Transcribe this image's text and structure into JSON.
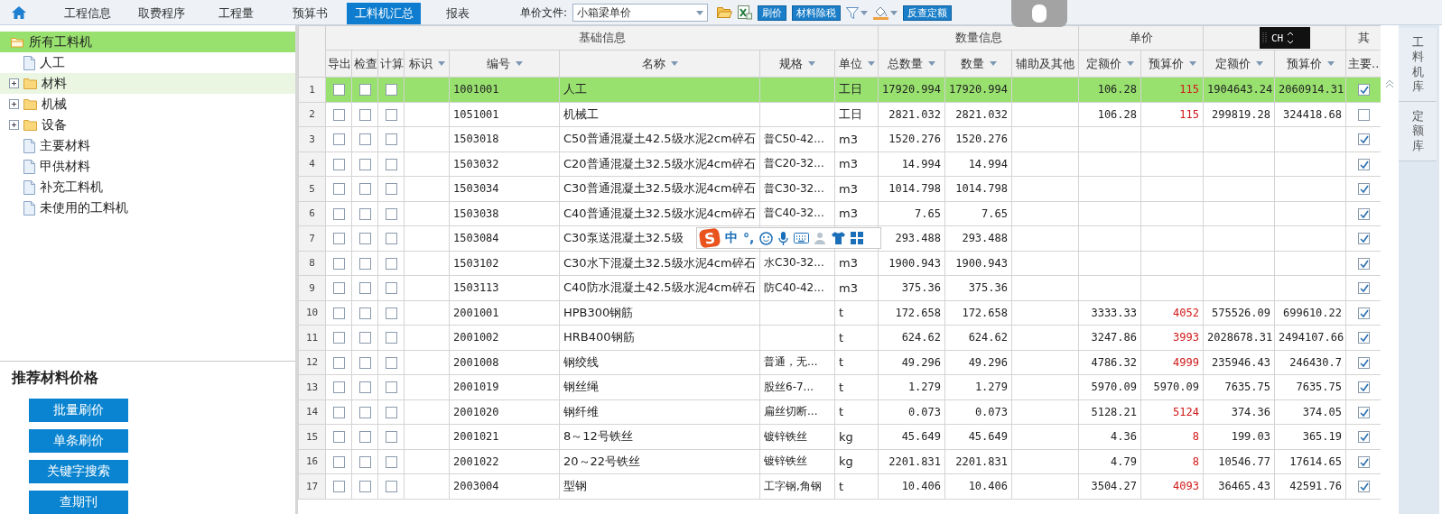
{
  "nav": {
    "tabs": [
      {
        "label": "工程信息",
        "selected": false
      },
      {
        "label": "取费程序",
        "selected": false
      },
      {
        "label": "工程量",
        "selected": false
      },
      {
        "label": "预算书",
        "selected": false
      },
      {
        "label": "工料机汇总",
        "selected": true
      },
      {
        "label": "报表",
        "selected": false
      }
    ]
  },
  "toolbar": {
    "price_file_label": "单价文件:",
    "price_file": "小箱梁单价",
    "tools": [
      {
        "kind": "folder"
      },
      {
        "kind": "excel"
      },
      {
        "kind": "button",
        "label": "刷价"
      },
      {
        "kind": "button",
        "label": "材料除税"
      },
      {
        "kind": "filter"
      },
      {
        "kind": "fill"
      },
      {
        "kind": "button",
        "label": "反查定额"
      }
    ]
  },
  "tree": [
    {
      "label": "所有工料机",
      "kind": "folder",
      "selected": true,
      "expanded": true,
      "children": [
        {
          "label": "人工",
          "kind": "file",
          "selected": false,
          "hovered": false
        },
        {
          "label": "材料",
          "kind": "folder",
          "selected": false,
          "hovered": true,
          "expanded": false
        },
        {
          "label": "机械",
          "kind": "folder",
          "selected": false,
          "hovered": false,
          "expanded": false
        },
        {
          "label": "设备",
          "kind": "folder",
          "selected": false,
          "hovered": false,
          "expanded": false
        },
        {
          "label": "主要材料",
          "kind": "file",
          "selected": false,
          "hovered": false
        },
        {
          "label": "甲供材料",
          "kind": "file",
          "selected": false,
          "hovered": false
        },
        {
          "label": "补充工料机",
          "kind": "file",
          "selected": false,
          "hovered": false
        },
        {
          "label": "未使用的工料机",
          "kind": "file",
          "selected": false,
          "hovered": false
        }
      ]
    }
  ],
  "recommend": {
    "title": "推荐材料价格",
    "buttons": [
      "批量刷价",
      "单条刷价",
      "关键字搜索",
      "查期刊"
    ]
  },
  "table": {
    "groups": [
      {
        "label": "基础信息",
        "columns": [
          {
            "label": "导出",
            "sortable": false
          },
          {
            "label": "检查",
            "sortable": false
          },
          {
            "label": "计算",
            "sortable": false
          },
          {
            "label": "标识",
            "sortable": true
          },
          {
            "label": "编号",
            "sortable": true
          },
          {
            "label": "名称",
            "sortable": true
          },
          {
            "label": "规格",
            "sortable": true
          },
          {
            "label": "单位",
            "sortable": true
          }
        ]
      },
      {
        "label": "数量信息",
        "columns": [
          {
            "label": "总数量",
            "sortable": true
          },
          {
            "label": "数量",
            "sortable": true
          },
          {
            "label": "辅助及其他",
            "sortable": false
          }
        ]
      },
      {
        "label": "单价",
        "columns": [
          {
            "label": "定额价",
            "sortable": true
          },
          {
            "label": "预算价",
            "sortable": true
          }
        ]
      },
      {
        "columns": [
          {
            "label": "定额价",
            "sortable": true
          },
          {
            "label": "预算价",
            "sortable": true
          }
        ]
      },
      {
        "label": "其",
        "columns": [
          {
            "label": "主要..",
            "sortable": false
          }
        ]
      }
    ],
    "rows": [
      {
        "no": "1",
        "export": false,
        "check": false,
        "calc": false,
        "code": "1001001",
        "name": "人工",
        "unit": "工日",
        "total_qty": "17920.994",
        "qty": "17920.994",
        "quota_price": "106.28",
        "budget_price": "115",
        "price_adjusted": true,
        "quota_total": "1904643.24",
        "budget_total": "2060914.31",
        "main": true,
        "selected": true
      },
      {
        "no": "2",
        "export": false,
        "check": false,
        "calc": false,
        "code": "1051001",
        "name": "机械工",
        "unit": "工日",
        "total_qty": "2821.032",
        "qty": "2821.032",
        "quota_price": "106.28",
        "budget_price": "115",
        "price_adjusted": true,
        "quota_total": "299819.28",
        "budget_total": "324418.68",
        "main": false,
        "selected": false
      },
      {
        "no": "3",
        "export": false,
        "check": false,
        "calc": false,
        "code": "1503018",
        "name": "C50普通混凝土42.5级水泥2cm碎石",
        "spec": "普C50-42...",
        "unit": "m3",
        "total_qty": "1520.276",
        "qty": "1520.276",
        "main": true,
        "selected": false
      },
      {
        "no": "4",
        "export": false,
        "check": false,
        "calc": false,
        "code": "1503032",
        "name": "C20普通混凝土32.5级水泥4cm碎石",
        "spec": "普C20-32...",
        "unit": "m3",
        "total_qty": "14.994",
        "qty": "14.994",
        "main": true,
        "selected": false
      },
      {
        "no": "5",
        "export": false,
        "check": false,
        "calc": false,
        "code": "1503034",
        "name": "C30普通混凝土32.5级水泥4cm碎石",
        "spec": "普C30-32...",
        "unit": "m3",
        "total_qty": "1014.798",
        "qty": "1014.798",
        "main": true,
        "selected": false
      },
      {
        "no": "6",
        "export": false,
        "check": false,
        "calc": false,
        "code": "1503038",
        "name": "C40普通混凝土32.5级水泥4cm碎石",
        "spec": "普C40-32...",
        "unit": "m3",
        "total_qty": "7.65",
        "qty": "7.65",
        "main": true,
        "selected": false
      },
      {
        "no": "7",
        "export": false,
        "check": false,
        "calc": false,
        "code": "1503084",
        "name": "C30泵送混凝土32.5级",
        "total_qty": "293.488",
        "qty": "293.488",
        "main": true,
        "selected": false
      },
      {
        "no": "8",
        "export": false,
        "check": false,
        "calc": false,
        "code": "1503102",
        "name": "C30水下混凝土32.5级水泥4cm碎石",
        "spec": "水C30-32...",
        "unit": "m3",
        "total_qty": "1900.943",
        "qty": "1900.943",
        "main": true,
        "selected": false
      },
      {
        "no": "9",
        "export": false,
        "check": false,
        "calc": false,
        "code": "1503113",
        "name": "C40防水混凝土42.5级水泥4cm碎石",
        "spec": "防C40-42...",
        "unit": "m3",
        "total_qty": "375.36",
        "qty": "375.36",
        "main": true,
        "selected": false
      },
      {
        "no": "10",
        "export": false,
        "check": false,
        "calc": false,
        "code": "2001001",
        "name": "HPB300钢筋",
        "unit": "t",
        "total_qty": "172.658",
        "qty": "172.658",
        "quota_price": "3333.33",
        "budget_price": "4052",
        "price_adjusted": true,
        "quota_total": "575526.09",
        "budget_total": "699610.22",
        "main": true,
        "selected": false
      },
      {
        "no": "11",
        "export": false,
        "check": false,
        "calc": false,
        "code": "2001002",
        "name": "HRB400钢筋",
        "unit": "t",
        "total_qty": "624.62",
        "qty": "624.62",
        "quota_price": "3247.86",
        "budget_price": "3993",
        "price_adjusted": true,
        "quota_total": "2028678.31",
        "budget_total": "2494107.66",
        "main": true,
        "selected": false
      },
      {
        "no": "12",
        "export": false,
        "check": false,
        "calc": false,
        "code": "2001008",
        "name": "钢绞线",
        "spec": "普通，无...",
        "unit": "t",
        "total_qty": "49.296",
        "qty": "49.296",
        "quota_price": "4786.32",
        "budget_price": "4999",
        "price_adjusted": true,
        "quota_total": "235946.43",
        "budget_total": "246430.7",
        "main": true,
        "selected": false
      },
      {
        "no": "13",
        "export": false,
        "check": false,
        "calc": false,
        "code": "2001019",
        "name": "钢丝绳",
        "spec": "股丝6-7...",
        "unit": "t",
        "total_qty": "1.279",
        "qty": "1.279",
        "quota_price": "5970.09",
        "budget_price": "5970.09",
        "price_adjusted": false,
        "quota_total": "7635.75",
        "budget_total": "7635.75",
        "main": true,
        "selected": false
      },
      {
        "no": "14",
        "export": false,
        "check": false,
        "calc": false,
        "code": "2001020",
        "name": "钢纤维",
        "spec": "扁丝切断...",
        "unit": "t",
        "total_qty": "0.073",
        "qty": "0.073",
        "quota_price": "5128.21",
        "budget_price": "5124",
        "price_adjusted": true,
        "quota_total": "374.36",
        "budget_total": "374.05",
        "main": true,
        "selected": false
      },
      {
        "no": "15",
        "export": false,
        "check": false,
        "calc": false,
        "code": "2001021",
        "name": "8～12号铁丝",
        "spec": "镀锌铁丝",
        "unit": "kg",
        "total_qty": "45.649",
        "qty": "45.649",
        "quota_price": "4.36",
        "budget_price": "8",
        "price_adjusted": true,
        "quota_total": "199.03",
        "budget_total": "365.19",
        "main": true,
        "selected": false
      },
      {
        "no": "16",
        "export": false,
        "check": false,
        "calc": false,
        "code": "2001022",
        "name": "20～22号铁丝",
        "spec": "镀锌铁丝",
        "unit": "kg",
        "total_qty": "2201.831",
        "qty": "2201.831",
        "quota_price": "4.79",
        "budget_price": "8",
        "price_adjusted": true,
        "quota_total": "10546.77",
        "budget_total": "17614.65",
        "main": true,
        "selected": false
      },
      {
        "no": "17",
        "export": false,
        "check": false,
        "calc": false,
        "code": "2003004",
        "name": "型钢",
        "spec": "工字钢,角钢",
        "unit": "t",
        "total_qty": "10.406",
        "qty": "10.406",
        "quota_price": "3504.27",
        "budget_price": "4093",
        "price_adjusted": true,
        "quota_total": "36465.43",
        "budget_total": "42591.76",
        "main": true,
        "selected": false
      }
    ]
  },
  "side_tabs": [
    "工料机库",
    "定额库"
  ],
  "ime_bar": {
    "logo": "S",
    "mode": "中",
    "punct": "°,"
  },
  "ch_widget": {
    "label": "CH"
  }
}
